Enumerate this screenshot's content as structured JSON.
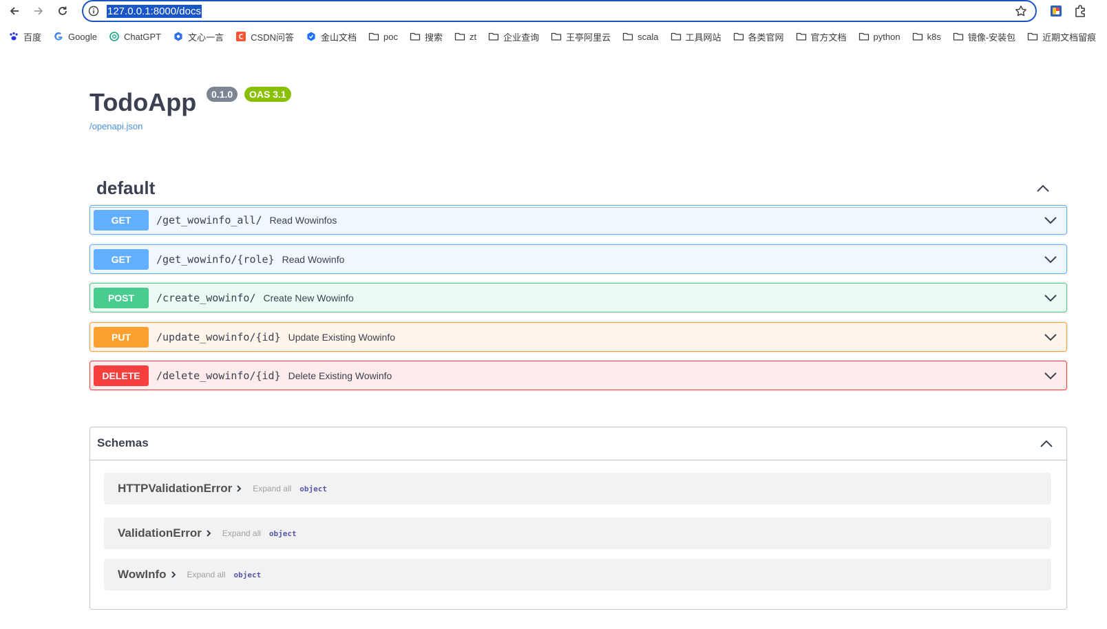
{
  "browser": {
    "url": "127.0.0.1:8000/docs",
    "bookmarks": [
      {
        "label": "百度",
        "icon": "paw-icon",
        "color": "#2932e1"
      },
      {
        "label": "Google",
        "icon": "google-icon",
        "color": "#4285f4"
      },
      {
        "label": "ChatGPT",
        "icon": "openai-icon",
        "color": "#10a37f"
      },
      {
        "label": "文心一言",
        "icon": "ernie-icon",
        "color": "#2f6fed"
      },
      {
        "label": "CSDN问答",
        "icon": "csdn-icon",
        "color": "#fc5531"
      },
      {
        "label": "金山文档",
        "icon": "kdocs-icon",
        "color": "#1e6fff"
      },
      {
        "label": "poc",
        "icon": "folder-icon"
      },
      {
        "label": "搜索",
        "icon": "folder-icon"
      },
      {
        "label": "zt",
        "icon": "folder-icon"
      },
      {
        "label": "企业查询",
        "icon": "folder-icon"
      },
      {
        "label": "王亭阿里云",
        "icon": "folder-icon"
      },
      {
        "label": "scala",
        "icon": "folder-icon"
      },
      {
        "label": "工具网站",
        "icon": "folder-icon"
      },
      {
        "label": "各类官网",
        "icon": "folder-icon"
      },
      {
        "label": "官方文档",
        "icon": "folder-icon"
      },
      {
        "label": "python",
        "icon": "folder-icon"
      },
      {
        "label": "k8s",
        "icon": "folder-icon"
      },
      {
        "label": "镜像-安装包",
        "icon": "folder-icon"
      },
      {
        "label": "近期文档留痕",
        "icon": "folder-icon"
      }
    ]
  },
  "info": {
    "title": "TodoApp",
    "version": "0.1.0",
    "oas": "OAS 3.1",
    "spec_link": "/openapi.json"
  },
  "tag": {
    "name": "default"
  },
  "operations": [
    {
      "method": "GET",
      "path": "/get_wowinfo_all/",
      "summary": "Read Wowinfos",
      "kind": "get"
    },
    {
      "method": "GET",
      "path": "/get_wowinfo/{role}",
      "summary": "Read Wowinfo",
      "kind": "get"
    },
    {
      "method": "POST",
      "path": "/create_wowinfo/",
      "summary": "Create New Wowinfo",
      "kind": "post"
    },
    {
      "method": "PUT",
      "path": "/update_wowinfo/{id}",
      "summary": "Update Existing Wowinfo",
      "kind": "put"
    },
    {
      "method": "DELETE",
      "path": "/delete_wowinfo/{id}",
      "summary": "Delete Existing Wowinfo",
      "kind": "delete"
    }
  ],
  "schemas": {
    "title": "Schemas",
    "models": [
      {
        "name": "HTTPValidationError",
        "expand": "Expand all",
        "type": "object"
      },
      {
        "name": "ValidationError",
        "expand": "Expand all",
        "type": "object"
      },
      {
        "name": "WowInfo",
        "expand": "Expand all",
        "type": "object"
      }
    ]
  },
  "colors": {
    "accent": "#1a55c7",
    "get": "#61affe",
    "post": "#49cc90",
    "put": "#fca130",
    "delete": "#f93e3e"
  }
}
